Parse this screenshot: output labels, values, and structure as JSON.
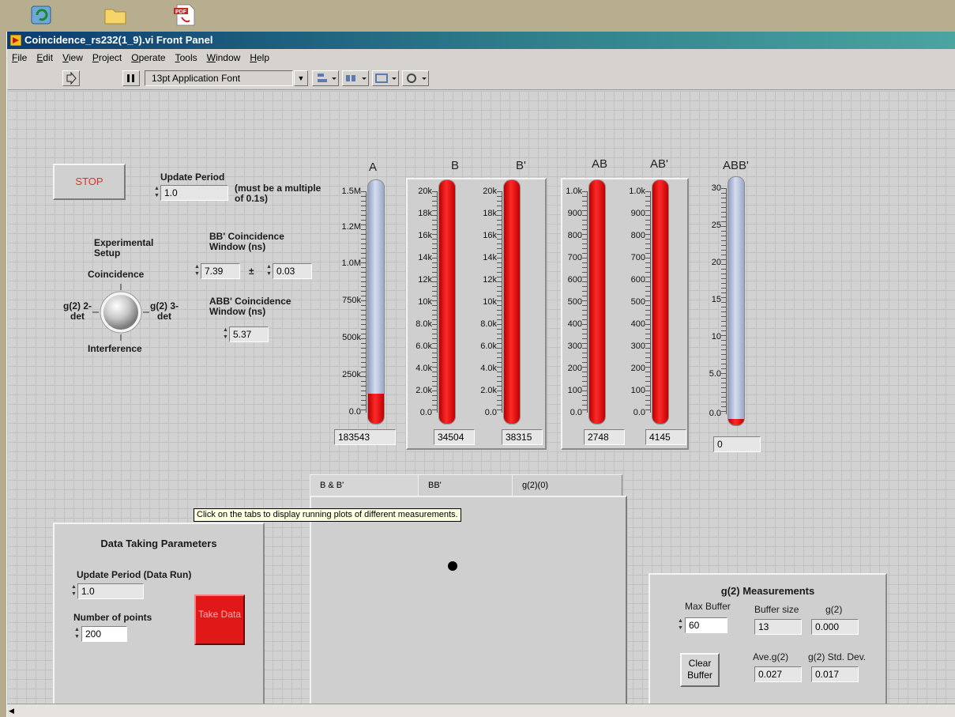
{
  "window": {
    "title": "Coincidence_rs232(1_9).vi Front Panel"
  },
  "menu": [
    "File",
    "Edit",
    "View",
    "Project",
    "Operate",
    "Tools",
    "Window",
    "Help"
  ],
  "toolbar": {
    "font": "13pt Application Font"
  },
  "controls": {
    "stop_label": "STOP",
    "update_period_label": "Update Period",
    "update_period_value": "1.0",
    "update_period_note": "(must be a multiple of 0.1s)",
    "experimental_setup_label": "Experimental Setup",
    "knob_top": "Coincidence",
    "knob_left": "g(2) 2-det",
    "knob_right": "g(2) 3-det",
    "knob_bottom": "Interference",
    "bb_window_label": "BB' Coincidence Window (ns)",
    "bb_window_value": "7.39",
    "bb_window_pm": "±",
    "bb_window_tol": "0.03",
    "abb_window_label": "ABB' Coincidence Window (ns)",
    "abb_window_value": "5.37"
  },
  "meters": {
    "A": {
      "label": "A",
      "ticks": [
        "1.5M",
        "1.2M",
        "1.0M",
        "750k",
        "500k",
        "250k",
        "0.0"
      ],
      "max": 1500000,
      "value": "183543",
      "fill": 0.1224
    },
    "B": {
      "label": "B",
      "ticks": [
        "20k",
        "18k",
        "16k",
        "14k",
        "12k",
        "10k",
        "8.0k",
        "6.0k",
        "4.0k",
        "2.0k",
        "0.0"
      ],
      "max": 20000,
      "value": "34504",
      "fill": 1.0
    },
    "Bp": {
      "label": "B'",
      "ticks": [
        "20k",
        "18k",
        "16k",
        "14k",
        "12k",
        "10k",
        "8.0k",
        "6.0k",
        "4.0k",
        "2.0k",
        "0.0"
      ],
      "max": 20000,
      "value": "38315",
      "fill": 1.0
    },
    "AB": {
      "label": "AB",
      "ticks": [
        "1.0k",
        "900",
        "800",
        "700",
        "600",
        "500",
        "400",
        "300",
        "200",
        "100",
        "0.0"
      ],
      "max": 1000,
      "value": "2748",
      "fill": 1.0
    },
    "ABp": {
      "label": "AB'",
      "ticks": [
        "1.0k",
        "900",
        "800",
        "700",
        "600",
        "500",
        "400",
        "300",
        "200",
        "100",
        "0.0"
      ],
      "max": 1000,
      "value": "4145",
      "fill": 1.0
    },
    "ABBp": {
      "label": "ABB'",
      "ticks": [
        "30",
        "25",
        "20",
        "15",
        "10",
        "5.0",
        "0.0"
      ],
      "max": 30,
      "value": "0",
      "fill": 0.0
    }
  },
  "tabs": [
    "B & B'",
    "BB'",
    "g(2)(0)"
  ],
  "tooltip": "Click on the tabs to display running plots of different measurements.",
  "data_params": {
    "title": "Data Taking Parameters",
    "update_label": "Update Period (Data Run)",
    "update_value": "1.0",
    "points_label": "Number of points",
    "points_value": "200",
    "take_data": "Take Data"
  },
  "g2": {
    "title": "g(2) Measurements",
    "max_buffer_label": "Max Buffer",
    "max_buffer_value": "60",
    "buffer_size_label": "Buffer size",
    "buffer_size_value": "13",
    "g2_label": "g(2)",
    "g2_value": "0.000",
    "clear_label": "Clear Buffer",
    "ave_label": "Ave.g(2)",
    "ave_value": "0.027",
    "std_label": "g(2) Std. Dev.",
    "std_value": "0.017"
  }
}
